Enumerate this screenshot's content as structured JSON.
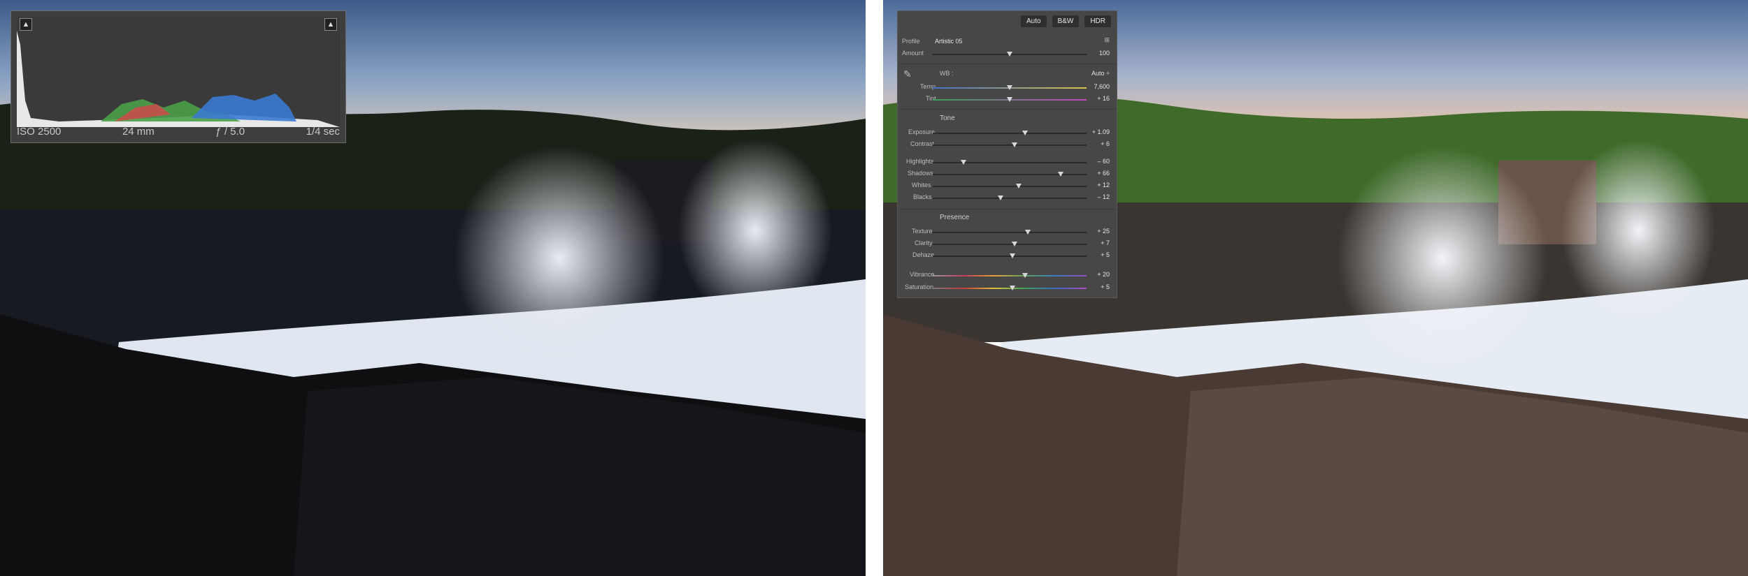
{
  "histogram": {
    "iso": "ISO 2500",
    "focal_length": "24 mm",
    "aperture": "ƒ / 5.0",
    "shutter": "1/4 sec",
    "clip_shadow_icon": "triangle-warning-icon",
    "clip_highlight_icon": "triangle-warning-icon"
  },
  "panel": {
    "buttons": {
      "auto": "Auto",
      "bw": "B&W",
      "hdr": "HDR"
    },
    "profile": {
      "label": "Profile",
      "value": "Artistic 05",
      "grid_icon": "profile-browser-icon"
    },
    "amount": {
      "label": "Amount",
      "value": "100",
      "level": 0.5
    },
    "wb": {
      "label": "WB :",
      "value": "Auto ÷",
      "eyedropper_icon": "eyedropper-icon"
    },
    "temp": {
      "label": "Temp",
      "value": "7,600",
      "level": 0.5
    },
    "tint": {
      "label": "Tint",
      "value": "+ 16",
      "level": 0.5
    },
    "tone_title": "Tone",
    "exposure": {
      "label": "Exposure",
      "value": "+ 1.09",
      "level": 0.6
    },
    "contrast": {
      "label": "Contrast",
      "value": "+ 6",
      "level": 0.53
    },
    "highlights": {
      "label": "Highlights",
      "value": "– 60",
      "level": 0.2
    },
    "shadows": {
      "label": "Shadows",
      "value": "+ 66",
      "level": 0.83
    },
    "whites": {
      "label": "Whites",
      "value": "+ 12",
      "level": 0.56
    },
    "blacks": {
      "label": "Blacks",
      "value": "– 12",
      "level": 0.44
    },
    "presence_title": "Presence",
    "texture": {
      "label": "Texture",
      "value": "+ 25",
      "level": 0.62
    },
    "clarity": {
      "label": "Clarity",
      "value": "+ 7",
      "level": 0.53
    },
    "dehaze": {
      "label": "Dehaze",
      "value": "+ 5",
      "level": 0.52
    },
    "vibrance": {
      "label": "Vibrance",
      "value": "+ 20",
      "level": 0.6
    },
    "saturation": {
      "label": "Saturation",
      "value": "+ 5",
      "level": 0.52
    }
  },
  "colors": {
    "panel_bg": "#474747",
    "histo_bg": "#3e3e3e",
    "divider": "#ffffff"
  }
}
